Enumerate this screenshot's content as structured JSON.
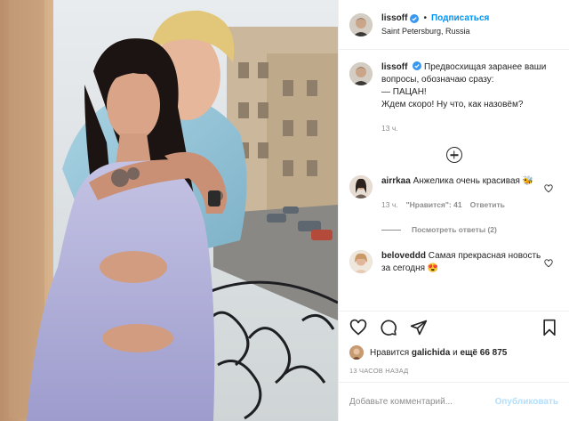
{
  "post": {
    "username": "lissoff",
    "follow_label": "Подписаться",
    "location": "Saint Petersburg, Russia"
  },
  "caption": {
    "username": "lissoff",
    "text": "Предвосхищая заранее ваши вопросы, обозначаю сразу:\n— ПАЦАН!\nЖдем скоро! Ну что, как назовём?",
    "time": "13 ч."
  },
  "comments": [
    {
      "username": "airrkaa",
      "text": "Анжелика очень красивая 🐝",
      "time": "13 ч.",
      "likes": "\"Нравится\": 41",
      "reply_label": "Ответить",
      "view_replies": "Посмотреть ответы (2)"
    },
    {
      "username": "beloveddd",
      "text": "Самая прекрасная новость за сегодня 😍"
    }
  ],
  "likes": {
    "prefix": "Нравится",
    "user": "galichida",
    "and": "и",
    "count_text": "ещё 66 875"
  },
  "posted_ago": "13 ЧАСОВ НАЗАД",
  "add_comment": {
    "placeholder": "Добавьте комментарий...",
    "publish_label": "Опубликовать"
  },
  "colors": {
    "accent": "#0095f6",
    "publish_disabled": "#b2dffc",
    "muted": "#8e8e8e",
    "border": "#efefef"
  },
  "icons": [
    "verified-badge-icon",
    "add-comment-plus-icon",
    "heart-icon",
    "comment-icon",
    "share-icon",
    "bookmark-icon"
  ]
}
